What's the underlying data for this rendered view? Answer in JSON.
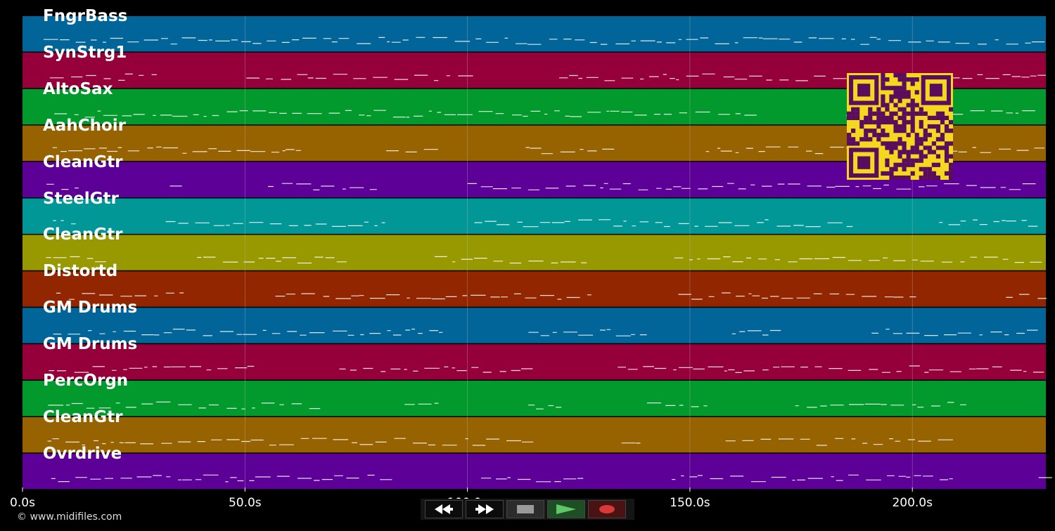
{
  "time_axis": {
    "max_seconds": 230,
    "ticks": [
      {
        "value": 0,
        "label": "0.0s"
      },
      {
        "value": 50,
        "label": "50.0s"
      },
      {
        "value": 100,
        "label": "100.0s"
      },
      {
        "value": 150,
        "label": "150.0s"
      },
      {
        "value": 200,
        "label": "200.0s"
      }
    ]
  },
  "tracks": [
    {
      "name": "FngrBass",
      "color": "#01659a"
    },
    {
      "name": "SynStrg1",
      "color": "#96003a"
    },
    {
      "name": "AltoSax",
      "color": "#029a2c"
    },
    {
      "name": "AahChoir",
      "color": "#976200"
    },
    {
      "name": "CleanGtr",
      "color": "#5c0097"
    },
    {
      "name": "SteelGtr",
      "color": "#029797"
    },
    {
      "name": "CleanGtr",
      "color": "#989800"
    },
    {
      "name": "Distortd",
      "color": "#912600"
    },
    {
      "name": "GM Drums",
      "color": "#01659a"
    },
    {
      "name": "GM Drums",
      "color": "#96003a"
    },
    {
      "name": "PercOrgn",
      "color": "#029a2c"
    },
    {
      "name": "CleanGtr",
      "color": "#976200"
    },
    {
      "name": "Ovrdrive",
      "color": "#5c0097"
    }
  ],
  "copyright": "© www.midifiles.com",
  "transport": {
    "rewind_icon": "rewind-icon",
    "forward_icon": "fast-forward-icon",
    "stop_icon": "stop-icon",
    "play_icon": "play-icon",
    "record_icon": "record-icon"
  },
  "colors": {
    "qr_fg": "#5a0d5c",
    "qr_bg": "#f4d81f",
    "grid": "#bdbdbd"
  }
}
